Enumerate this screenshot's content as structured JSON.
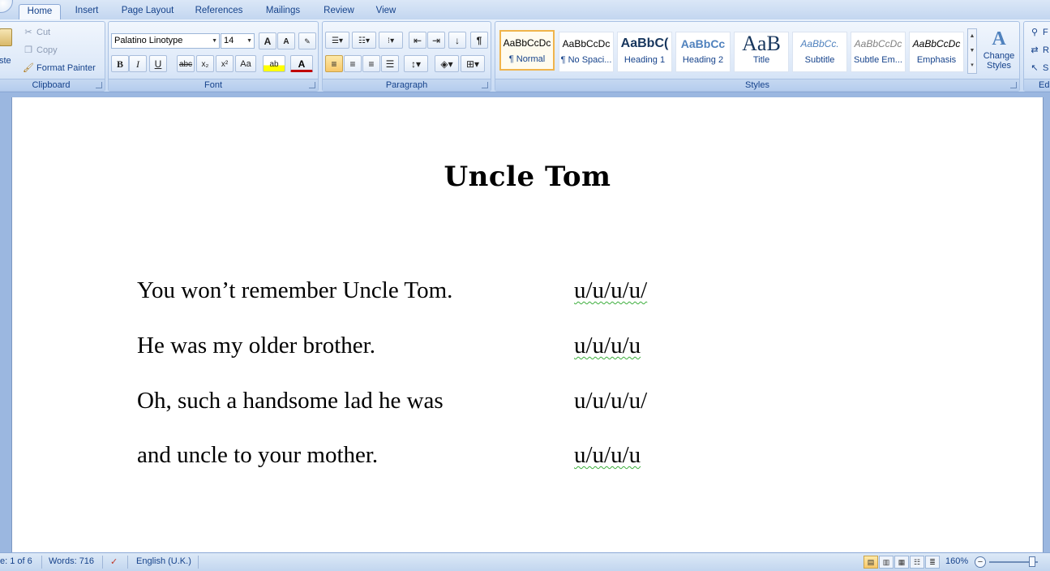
{
  "tabs": [
    "Home",
    "Insert",
    "Page Layout",
    "References",
    "Mailings",
    "Review",
    "View"
  ],
  "clipboard": {
    "paste_label": "ste",
    "cut": "Cut",
    "copy": "Copy",
    "format_painter": "Format Painter",
    "group": "Clipboard"
  },
  "font": {
    "name": "Palatino Linotype",
    "size": "14",
    "group": "Font",
    "grow": "A",
    "shrink": "A",
    "bold": "B",
    "italic": "I",
    "underline": "U",
    "strike": "abc",
    "subscript": "x₂",
    "superscript": "x²",
    "change_case": "Aa",
    "highlight": "ab",
    "font_color": "A"
  },
  "paragraph": {
    "group": "Paragraph",
    "show_marks": "¶"
  },
  "styles": {
    "group": "Styles",
    "items": [
      {
        "sample": "AaBbCcDc",
        "name": "¶ Normal"
      },
      {
        "sample": "AaBbCcDc",
        "name": "¶ No Spaci..."
      },
      {
        "sample": "AaBbC(",
        "name": "Heading 1"
      },
      {
        "sample": "AaBbCc",
        "name": "Heading 2"
      },
      {
        "sample": "AaB",
        "name": "Title"
      },
      {
        "sample": "AaBbCc.",
        "name": "Subtitle"
      },
      {
        "sample": "AaBbCcDc",
        "name": "Subtle Em..."
      },
      {
        "sample": "AaBbCcDc",
        "name": "Emphasis"
      }
    ],
    "change_styles": "Change Styles"
  },
  "editing": {
    "find": "F",
    "replace": "R",
    "select": "S",
    "group": "Ed"
  },
  "document": {
    "title": "Uncle Tom",
    "lines": [
      {
        "text": "You won’t remember Uncle Tom.",
        "meter": "u/u/u/u/"
      },
      {
        "text": "He was my older brother.",
        "meter": "u/u/u/u"
      },
      {
        "text": "Oh, such a handsome lad he was",
        "meter": "u/u/u/u/"
      },
      {
        "text": "and uncle to your mother.",
        "meter": "u/u/u/u"
      }
    ]
  },
  "status": {
    "page": "e: 1 of 6",
    "words": "Words: 716",
    "language": "English (U.K.)",
    "zoom": "160%",
    "zoom_minus": "−"
  },
  "colors": {
    "ribbon": "#dbe7f7",
    "accent": "#15428b",
    "selected": "#f8c86a"
  }
}
